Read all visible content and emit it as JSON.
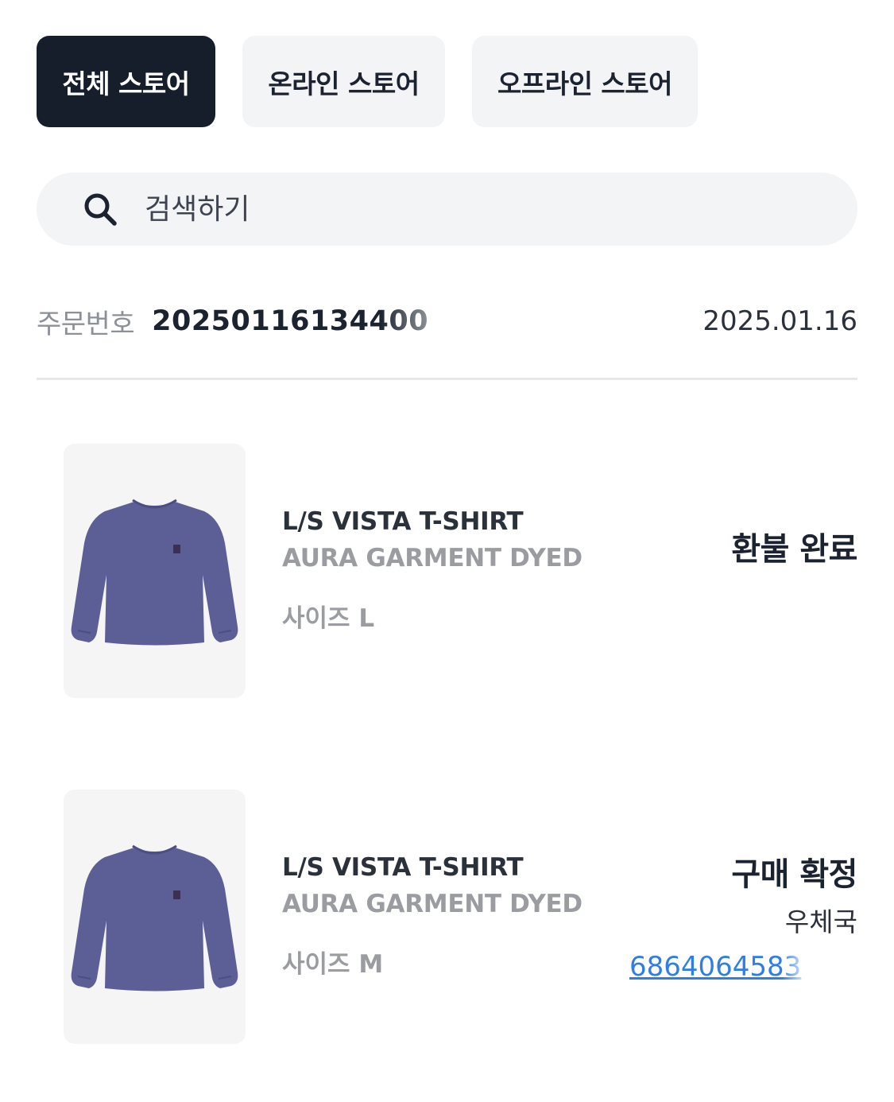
{
  "tabs": [
    {
      "label": "전체 스토어",
      "active": true
    },
    {
      "label": "온라인 스토어",
      "active": false
    },
    {
      "label": "오프라인 스토어",
      "active": false
    }
  ],
  "search": {
    "placeholder": "검색하기",
    "icon": "search-icon"
  },
  "order": {
    "label": "주문번호",
    "number": "20250116134400",
    "date": "2025.01.16"
  },
  "items": [
    {
      "name": "L/S VISTA T-SHIRT",
      "color": "AURA GARMENT DYED",
      "size": "사이즈 L",
      "status": "환불 완료",
      "image": "long-sleeve-tshirt-purple"
    },
    {
      "name": "L/S VISTA T-SHIRT",
      "color": "AURA GARMENT DYED",
      "size": "사이즈 M",
      "status": "구매 확정",
      "carrier": "우체국",
      "tracking": "6864064583",
      "image": "long-sleeve-tshirt-purple"
    }
  ],
  "colors": {
    "active_tab": "#161e2b",
    "tab_bg": "#f3f4f6",
    "link": "#2f7ee6",
    "shirt": "#5b5f95"
  }
}
